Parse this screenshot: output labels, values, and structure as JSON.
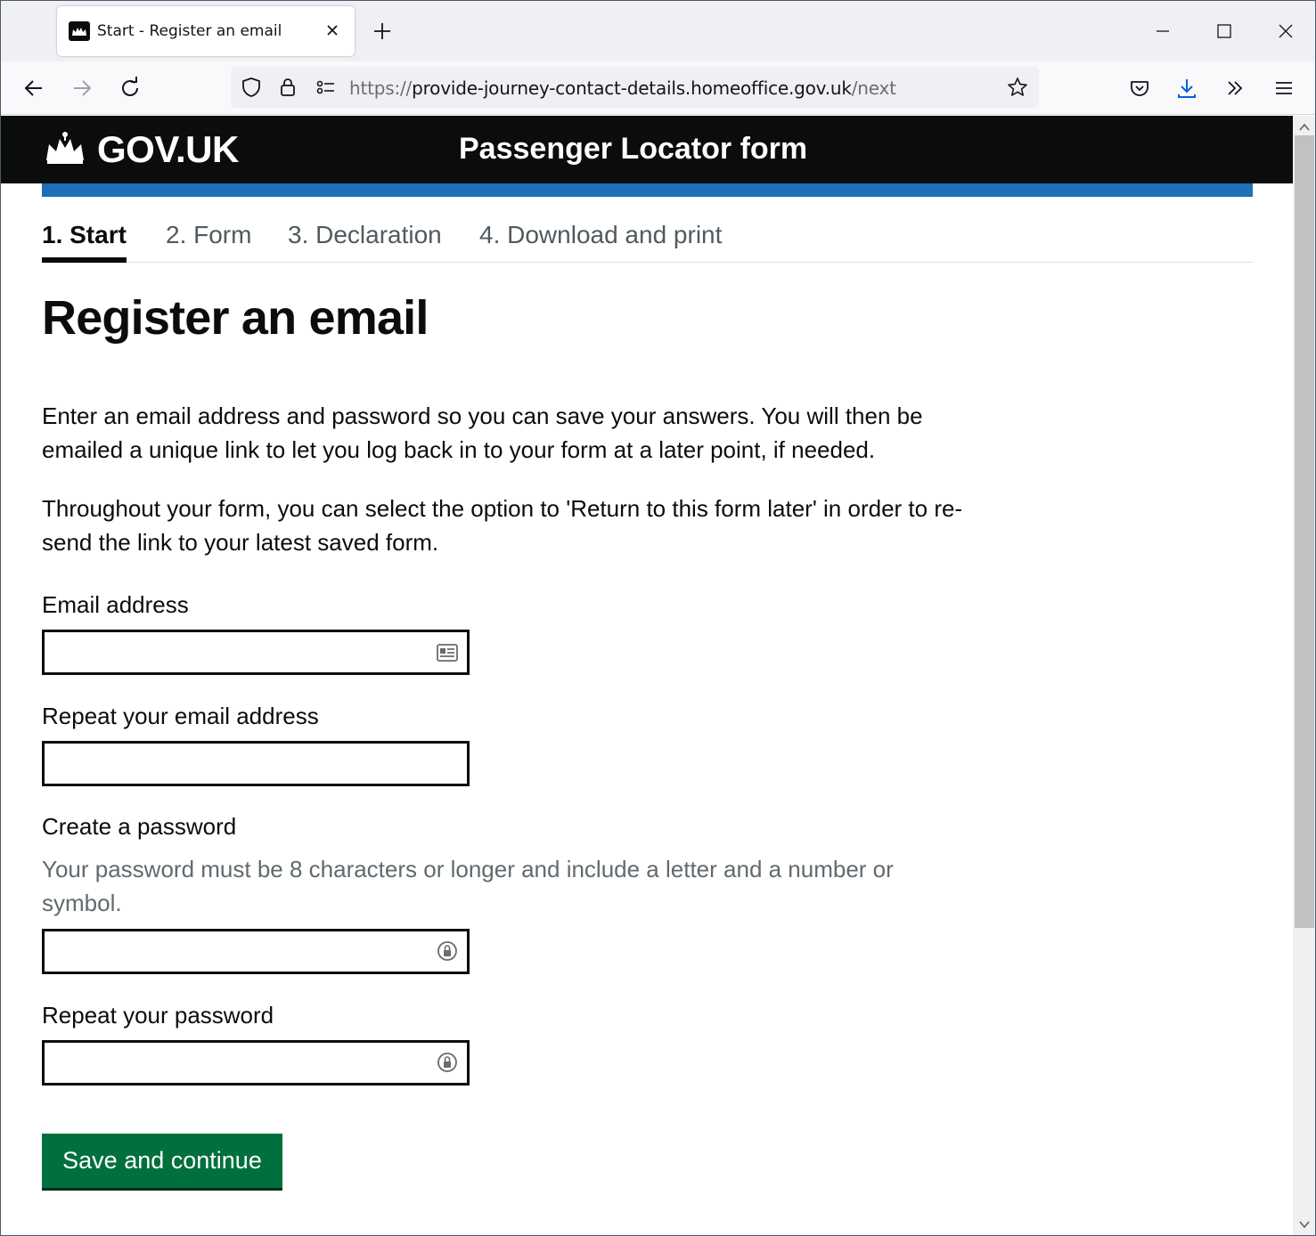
{
  "browser": {
    "tab_title": "Start - Register an email",
    "url_scheme": "https://",
    "url_host": "provide-journey-contact-details.homeoffice.gov.uk",
    "url_path": "/next"
  },
  "header": {
    "logo_text": "GOV.UK",
    "service_name": "Passenger Locator form"
  },
  "steps": [
    {
      "label": "1.  Start"
    },
    {
      "label": "2.  Form"
    },
    {
      "label": "3.  Declaration"
    },
    {
      "label": "4.  Download and print"
    }
  ],
  "active_step": 1,
  "main": {
    "heading": "Register an email",
    "intro_1": "Enter an email address and password so you can save your answers. You will then be emailed a unique link to let you log back in to your form at a later point, if needed.",
    "intro_2": "Throughout your form, you can select the option to 'Return to this form later' in order to re-send the link to your latest saved form."
  },
  "form": {
    "email_label": "Email address",
    "email_value": "",
    "repeat_email_label": "Repeat your email address",
    "repeat_email_value": "",
    "password_label": "Create a password",
    "password_hint": "Your password must be 8 characters or longer and include a letter and a number or symbol.",
    "password_value": "",
    "repeat_password_label": "Repeat your password",
    "repeat_password_value": "",
    "submit_label": "Save and continue"
  },
  "colors": {
    "header_bg": "#0b0c0c",
    "brand_blue": "#1d70b8",
    "button_green": "#00703c"
  }
}
